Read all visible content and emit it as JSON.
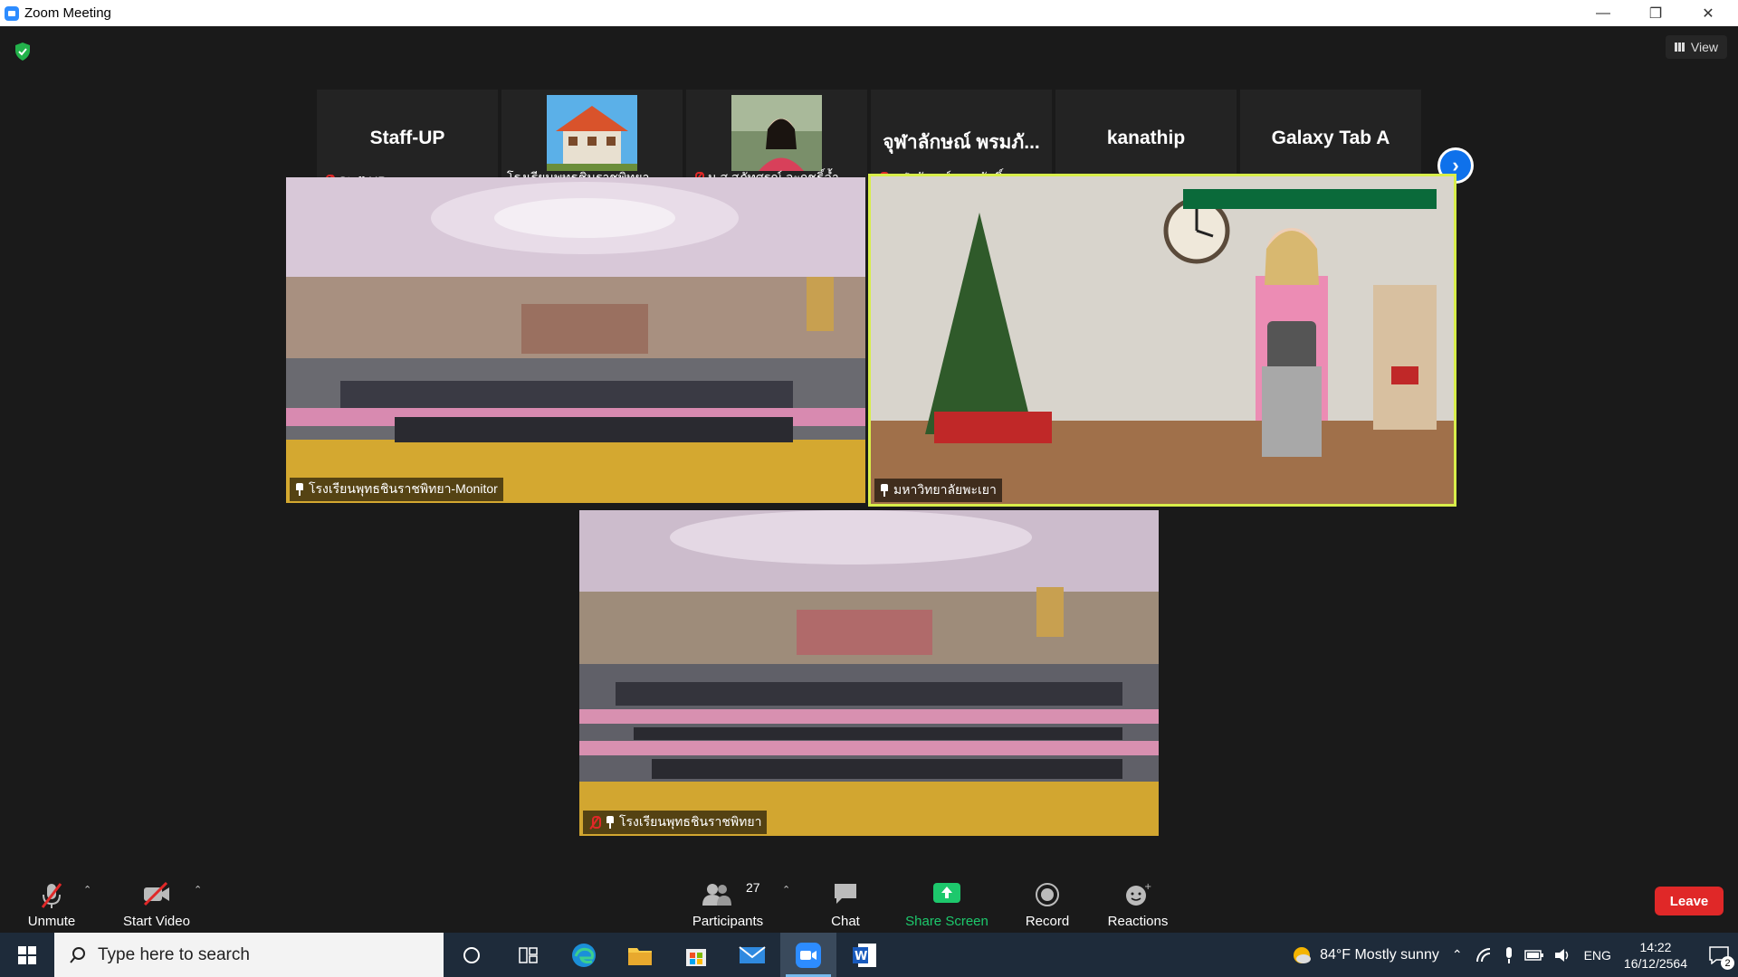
{
  "window": {
    "title": "Zoom Meeting",
    "view_label": "View"
  },
  "strip": [
    {
      "big": "Staff-UP",
      "name": "Staff-UP",
      "muted": true
    },
    {
      "big": "",
      "name": "โรงเรียนพุทธชินราชพิทยา",
      "muted": false,
      "has_pic": "building"
    },
    {
      "big": "",
      "name": "น.ส สุภัทศรณ์ จะฤชธิ์ล้ำ",
      "muted": true,
      "has_pic": "person"
    },
    {
      "big": "จุฬาลักษณ์ พรมภั...",
      "name": "จุฬาลักษณ์ พรมภักดิ์",
      "muted": true
    },
    {
      "big": "kanathip",
      "name": "kanathip",
      "muted": true
    },
    {
      "big": "Galaxy Tab A",
      "name": "Galaxy Tab A",
      "muted": true
    }
  ],
  "videos": {
    "v1_label": "โรงเรียนพุทธชินราชพิทยา-Monitor",
    "v2_label": "มหาวิทยาลัยพะเยา",
    "v3_label": "โรงเรียนพุทธชินราชพิทยา"
  },
  "toolbar": {
    "unmute": "Unmute",
    "start_video": "Start Video",
    "participants": "Participants",
    "participants_count": "27",
    "chat": "Chat",
    "share": "Share Screen",
    "record": "Record",
    "reactions": "Reactions",
    "leave": "Leave"
  },
  "taskbar": {
    "search_placeholder": "Type here to search",
    "weather": "84°F  Mostly sunny",
    "lang": "ENG",
    "time": "14:22",
    "date": "16/12/2564",
    "notif_count": "2"
  },
  "colors": {
    "accent": "#2d8cff",
    "leave": "#e02828",
    "active_speaker": "#d8ee4a",
    "share_green": "#1dc86c"
  }
}
